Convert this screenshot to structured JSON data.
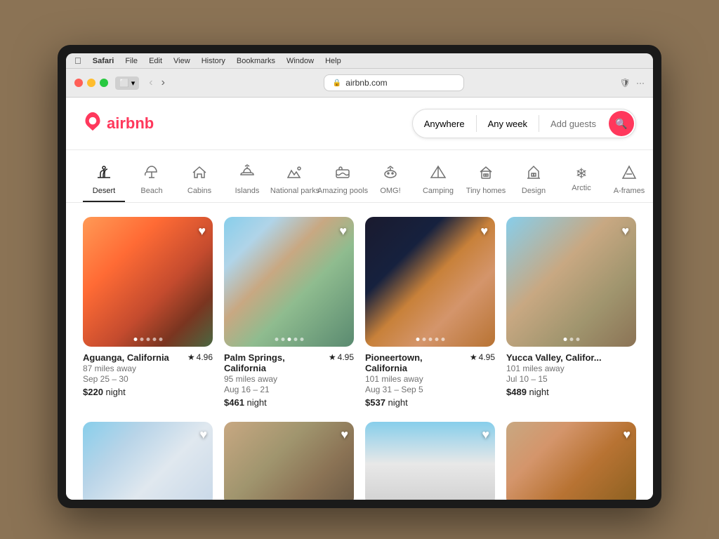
{
  "browser": {
    "url": "airbnb.com",
    "lock_icon": "🔒",
    "back_btn": "‹",
    "forward_btn": "›",
    "menu_items": [
      "Safari",
      "File",
      "Edit",
      "View",
      "History",
      "Bookmarks",
      "Window",
      "Help"
    ]
  },
  "airbnb": {
    "logo_text": "airbnb",
    "logo_icon": "✈",
    "search": {
      "anywhere": "Anywhere",
      "any_week": "Any week",
      "add_guests": "Add guests",
      "search_icon": "🔍"
    },
    "categories": [
      {
        "id": "desert",
        "label": "Desert",
        "icon": "🌵",
        "active": true
      },
      {
        "id": "beach",
        "label": "Beach",
        "icon": "🏖"
      },
      {
        "id": "cabins",
        "label": "Cabins",
        "icon": "🏠"
      },
      {
        "id": "islands",
        "label": "Islands",
        "icon": "🏝"
      },
      {
        "id": "national-parks",
        "label": "National parks",
        "icon": "⛰"
      },
      {
        "id": "amazing-pools",
        "label": "Amazing pools",
        "icon": "🏊"
      },
      {
        "id": "omg",
        "label": "OMG!",
        "icon": "🛸"
      },
      {
        "id": "camping",
        "label": "Camping",
        "icon": "⛺"
      },
      {
        "id": "tiny-homes",
        "label": "Tiny homes",
        "icon": "🏡"
      },
      {
        "id": "design",
        "label": "Design",
        "icon": "🏛"
      },
      {
        "id": "arctic",
        "label": "Arctic",
        "icon": "❄"
      },
      {
        "id": "a-frames",
        "label": "A-frames",
        "icon": "🔺"
      }
    ],
    "listings": [
      {
        "location": "Aguanga, California",
        "rating": "4.96",
        "distance": "87 miles away",
        "dates": "Sep 25 – 30",
        "price": "$220",
        "price_unit": "night",
        "image_class": "img-desert1",
        "dots": 5,
        "active_dot": 0,
        "wishlisted": false
      },
      {
        "location": "Palm Springs, California",
        "rating": "4.95",
        "distance": "95 miles away",
        "dates": "Aug 16 – 21",
        "price": "$461",
        "price_unit": "night",
        "image_class": "img-glass",
        "dots": 5,
        "active_dot": 2,
        "wishlisted": false
      },
      {
        "location": "Pioneertown, California",
        "rating": "4.95",
        "distance": "101 miles away",
        "dates": "Aug 31 – Sep 5",
        "price": "$537",
        "price_unit": "night",
        "image_class": "img-modern-desert",
        "dots": 5,
        "active_dot": 0,
        "wishlisted": false
      },
      {
        "location": "Yucca Valley, Califor...",
        "rating": "—",
        "distance": "101 miles away",
        "dates": "Jul 10 – 15",
        "price": "$489",
        "price_unit": "night",
        "image_class": "img-yucca",
        "dots": 3,
        "active_dot": 0,
        "wishlisted": false
      }
    ],
    "bottom_listings": [
      {
        "image_class": "img-bottom1",
        "wishlisted": false
      },
      {
        "image_class": "img-bottom2",
        "wishlisted": false
      },
      {
        "image_class": "img-bottom3",
        "wishlisted": false
      },
      {
        "image_class": "img-bottom4",
        "wishlisted": false
      }
    ]
  }
}
